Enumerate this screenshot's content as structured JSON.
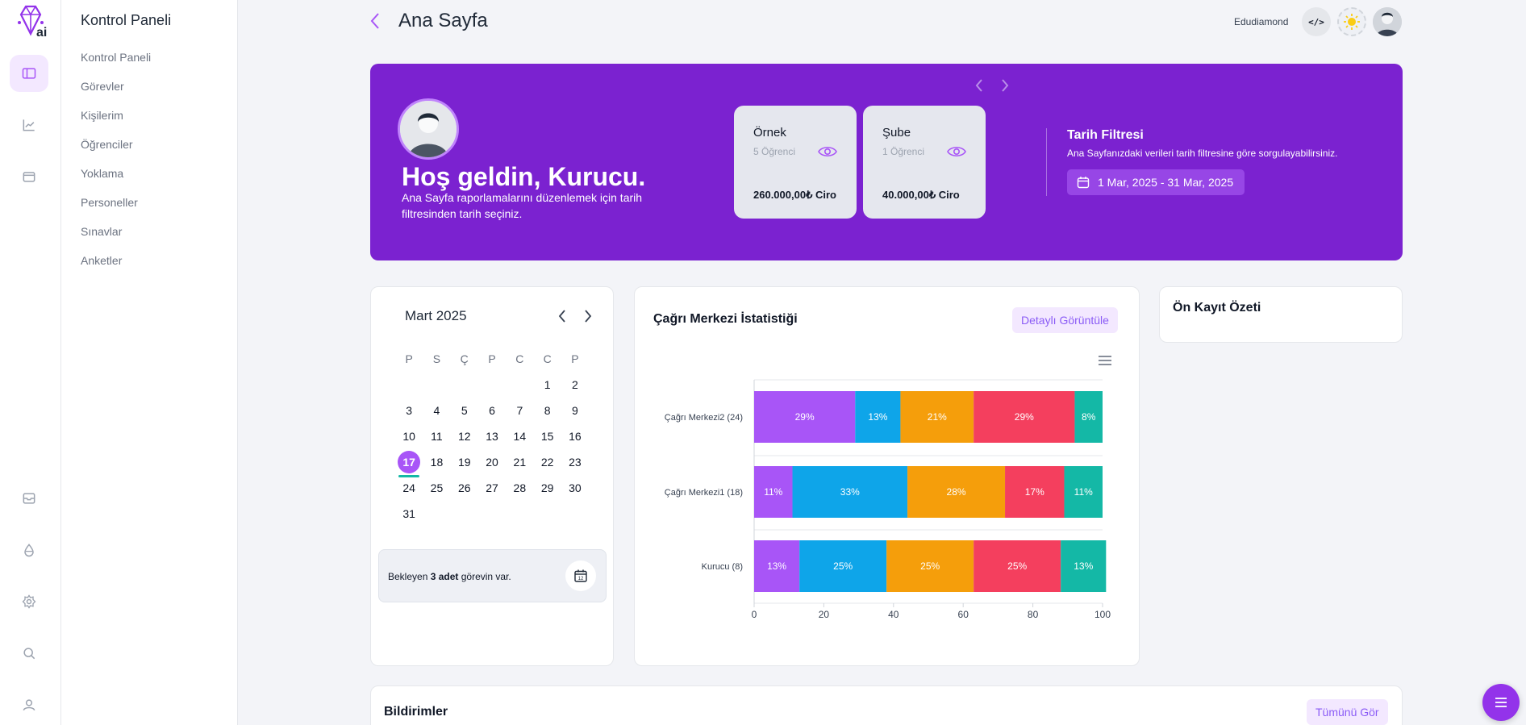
{
  "header": {
    "title": "Ana Sayfa",
    "user_name": "Edudiamond",
    "code_label": "</>"
  },
  "nav": {
    "title": "Kontrol Paneli",
    "items": [
      "Kontrol Paneli",
      "Görevler",
      "Kişilerim",
      "Öğrenciler",
      "Yoklama",
      "Personeller",
      "Sınavlar",
      "Anketler"
    ]
  },
  "rail": {
    "top_icons": [
      "sidebar-icon",
      "chart-line-icon",
      "wallet-icon"
    ],
    "bottom_icons": [
      "inbox-icon",
      "droplet-icon",
      "settings-icon",
      "search-icon",
      "user-icon"
    ]
  },
  "hero": {
    "title": "Hoş geldin, Kurucu.",
    "subtitle": "Ana Sayfa raporlamalarını düzenlemek için tarih filtresinden tarih seçiniz.",
    "cards": [
      {
        "name": "Örnek",
        "count": "5 Öğrenci",
        "value": "260.000,00₺ Ciro"
      },
      {
        "name": "Şube",
        "count": "1 Öğrenci",
        "value": "40.000,00₺ Ciro"
      }
    ],
    "filter_title": "Tarih Filtresi",
    "filter_subtitle": "Ana Sayfanızdaki verileri tarih filtresine göre sorgulayabilirsiniz.",
    "date_range": "1 Mar, 2025 - 31 Mar, 2025"
  },
  "calendar": {
    "month": "Mart 2025",
    "weekdays": [
      "P",
      "S",
      "Ç",
      "P",
      "C",
      "C",
      "P"
    ],
    "leading_blanks": 5,
    "days": 31,
    "today": 17,
    "task_prefix": "Bekleyen ",
    "task_bold": "3 adet",
    "task_suffix": " görevin var."
  },
  "chart_card": {
    "title": "Çağrı Merkezi İstatistiği",
    "detail_button": "Detaylı Görüntüle"
  },
  "chart_data": {
    "type": "bar",
    "orientation": "horizontal",
    "stacked": true,
    "categories": [
      "Çağrı Merkezi2 (24)",
      "Çağrı Merkezi1 (18)",
      "Kurucu (8)"
    ],
    "series_colors": [
      "#a855f7",
      "#0ea5e9",
      "#f59e0b",
      "#f43f5e",
      "#14b8a6"
    ],
    "series": [
      {
        "values": [
          29,
          11,
          13
        ]
      },
      {
        "values": [
          13,
          33,
          25
        ]
      },
      {
        "values": [
          21,
          28,
          25
        ]
      },
      {
        "values": [
          29,
          17,
          25
        ]
      },
      {
        "values": [
          8,
          11,
          13
        ]
      }
    ],
    "xlim": [
      0,
      100
    ],
    "xticks": [
      0,
      20,
      40,
      60,
      80,
      100
    ],
    "value_suffix": "%",
    "legend": "none"
  },
  "prereg": {
    "title": "Ön Kayıt Özeti"
  },
  "notifications": {
    "title": "Bildirimler",
    "see_all": "Tümünü Gör"
  },
  "colors": {
    "brand": "#7b22d0",
    "accent": "#a855f7",
    "background": "#f3f4f8"
  }
}
